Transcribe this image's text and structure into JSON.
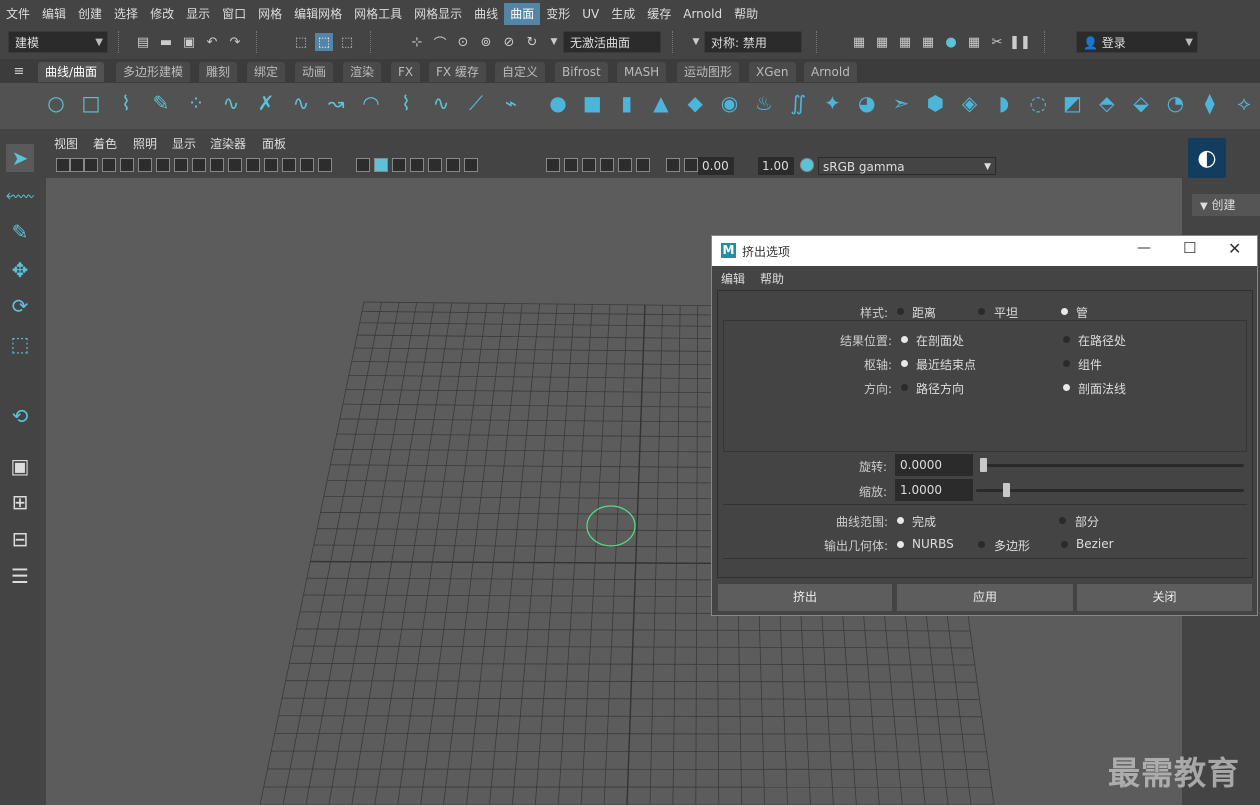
{
  "menubar": [
    "文件",
    "编辑",
    "创建",
    "选择",
    "修改",
    "显示",
    "窗口",
    "网格",
    "编辑网格",
    "网格工具",
    "网格显示",
    "曲线",
    "曲面",
    "变形",
    "UV",
    "生成",
    "缓存",
    "Arnold",
    "帮助"
  ],
  "menubar_active": "曲面",
  "statusline": {
    "mode": "建模",
    "live_surface": "无激活曲面",
    "symmetry": "对称: 禁用",
    "login": "登录"
  },
  "shelf_tabs": [
    "曲线/曲面",
    "多边形建模",
    "雕刻",
    "绑定",
    "动画",
    "渲染",
    "FX",
    "FX 缓存",
    "自定义",
    "Bifrost",
    "MASH",
    "运动图形",
    "XGen",
    "Arnold"
  ],
  "viewport": {
    "menu": [
      "视图",
      "着色",
      "照明",
      "显示",
      "渲染器",
      "面板"
    ],
    "exposure": "0.00",
    "gamma": "1.00",
    "colorspace": "sRGB gamma"
  },
  "right_panel": {
    "create_label": "创建"
  },
  "dialog": {
    "title": "挤出选项",
    "menu": [
      "编辑",
      "帮助"
    ],
    "style": {
      "label": "样式:",
      "options": [
        "距离",
        "平坦",
        "管"
      ],
      "selected": "管"
    },
    "result_position": {
      "label": "结果位置:",
      "options": [
        "在剖面处",
        "在路径处"
      ],
      "selected": "在剖面处"
    },
    "pivot": {
      "label": "枢轴:",
      "options": [
        "最近结束点",
        "组件"
      ],
      "selected": "最近结束点"
    },
    "orientation": {
      "label": "方向:",
      "options": [
        "路径方向",
        "剖面法线"
      ],
      "selected": "剖面法线"
    },
    "rotation": {
      "label": "旋转:",
      "value": "0.0000",
      "level": 0.0
    },
    "scale": {
      "label": "缩放:",
      "value": "1.0000",
      "level": 0.1
    },
    "curve_range": {
      "label": "曲线范围:",
      "options": [
        "完成",
        "部分"
      ],
      "selected": "完成"
    },
    "output_geometry": {
      "label": "输出几何体:",
      "options": [
        "NURBS",
        "多边形",
        "Bezier"
      ],
      "selected": "NURBS"
    },
    "buttons": {
      "extrude": "挤出",
      "apply": "应用",
      "close": "关闭"
    }
  },
  "watermark": "最需教育"
}
